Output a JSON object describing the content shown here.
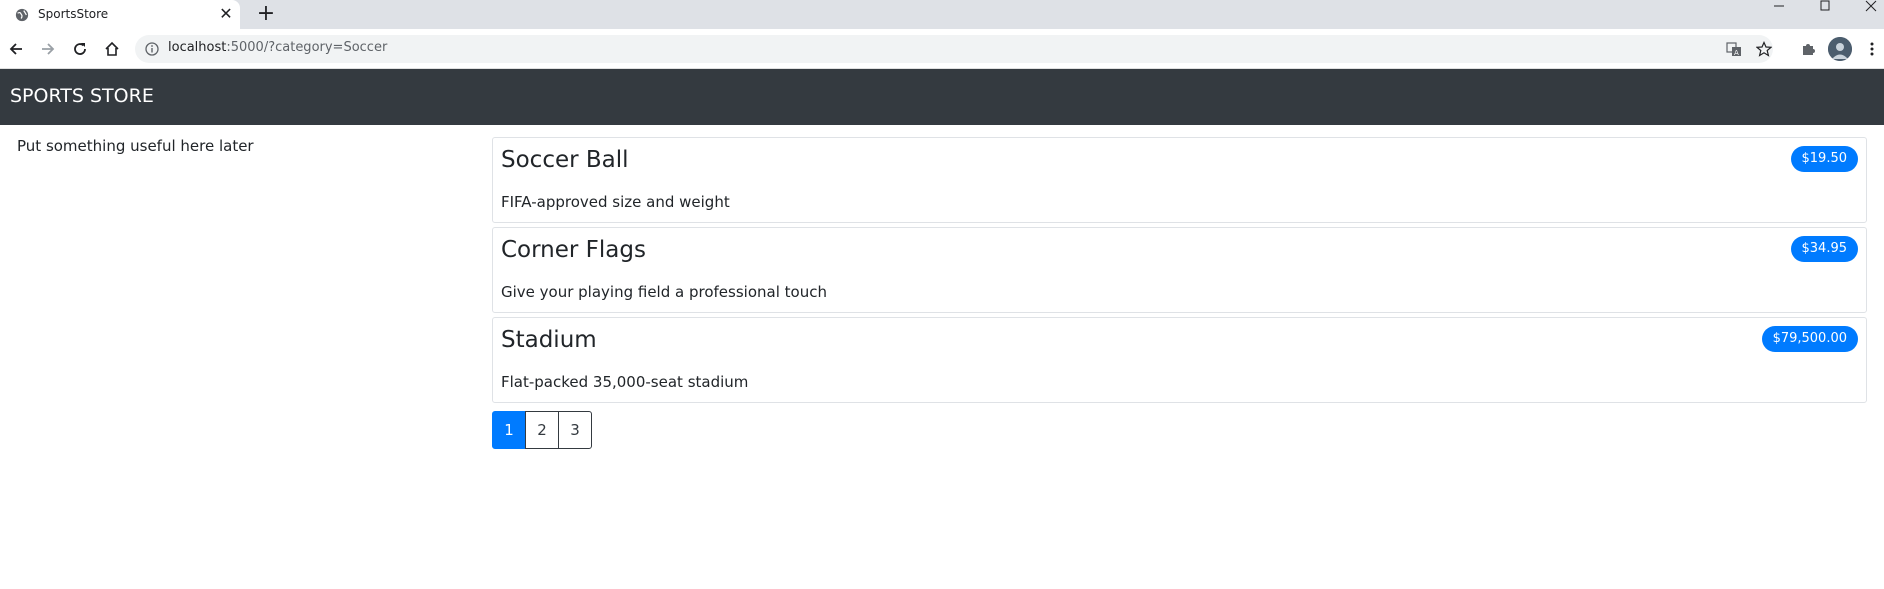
{
  "browser": {
    "tab_title": "SportsStore",
    "url_host": "localhost",
    "url_rest": ":5000/?category=Soccer",
    "new_tab_label": "+",
    "close_label": "✕"
  },
  "app": {
    "brand": "SPORTS STORE",
    "sidebar_text": "Put something useful here later"
  },
  "products": [
    {
      "name": "Soccer Ball",
      "description": "FIFA-approved size and weight",
      "price": "$19.50"
    },
    {
      "name": "Corner Flags",
      "description": "Give your playing field a professional touch",
      "price": "$34.95"
    },
    {
      "name": "Stadium",
      "description": "Flat-packed 35,000-seat stadium",
      "price": "$79,500.00"
    }
  ],
  "pagination": {
    "pages": [
      "1",
      "2",
      "3"
    ],
    "current": "1"
  },
  "colors": {
    "navbar": "#343a40",
    "accent": "#007bff"
  }
}
